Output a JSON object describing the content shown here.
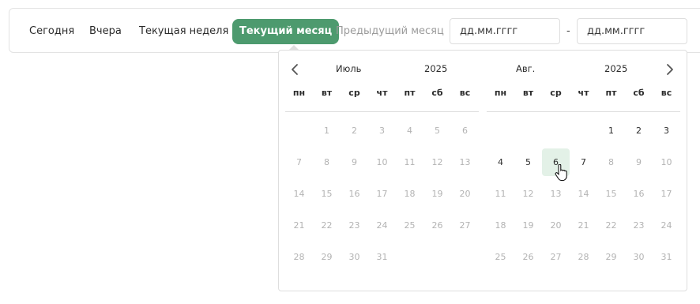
{
  "toolbar": {
    "today": "Сегодня",
    "yesterday": "Вчера",
    "current_week": "Текущая неделя",
    "current_month": "Текущий месяц",
    "previous_month": "Предыдущий месяц",
    "date_from_placeholder": "дд.мм.гггг",
    "date_to_placeholder": "дд.мм.гггг",
    "dash": "-"
  },
  "calendar": {
    "accent_color": "#4d9a6e",
    "hover_color": "#e3f1e7",
    "weekdays": [
      "пн",
      "вт",
      "ср",
      "чт",
      "пт",
      "сб",
      "вс"
    ],
    "left": {
      "month": "Июль",
      "year": "2025",
      "weeks": [
        [
          "",
          "1",
          "2",
          "3",
          "4",
          "5",
          "6"
        ],
        [
          "7",
          "8",
          "9",
          "10",
          "11",
          "12",
          "13"
        ],
        [
          "14",
          "15",
          "16",
          "17",
          "18",
          "19",
          "20"
        ],
        [
          "21",
          "22",
          "23",
          "24",
          "25",
          "26",
          "27"
        ],
        [
          "28",
          "29",
          "30",
          "31",
          "",
          "",
          ""
        ]
      ]
    },
    "right": {
      "month": "Авг.",
      "year": "2025",
      "weeks": [
        [
          "",
          "",
          "",
          "",
          "1",
          "2",
          "3"
        ],
        [
          "4",
          "5",
          "6",
          "7",
          "8",
          "9",
          "10"
        ],
        [
          "11",
          "12",
          "13",
          "14",
          "15",
          "16",
          "17"
        ],
        [
          "18",
          "19",
          "20",
          "21",
          "22",
          "23",
          "24"
        ],
        [
          "25",
          "26",
          "27",
          "28",
          "29",
          "30",
          "31"
        ]
      ],
      "selectable_days": [
        "1",
        "2",
        "3",
        "4",
        "5",
        "6",
        "7"
      ],
      "hovered_day": "6"
    }
  }
}
